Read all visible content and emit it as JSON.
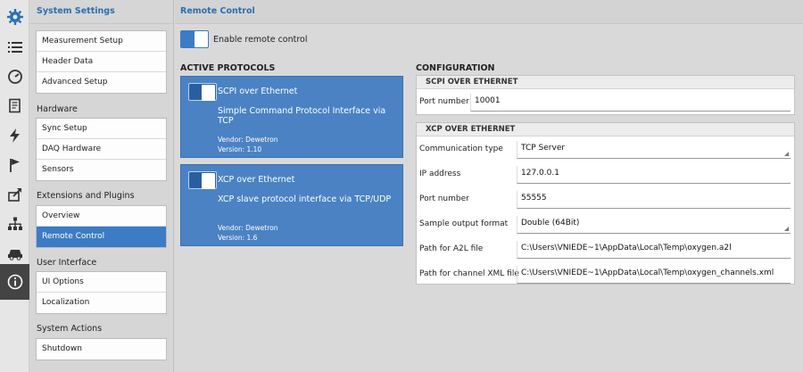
{
  "rail": {
    "icons": [
      "gear-icon",
      "list-icon",
      "gauge-icon",
      "document-icon",
      "lightning-icon",
      "flag-icon",
      "share-icon",
      "network-icon",
      "car-icon",
      "info-icon"
    ]
  },
  "sidebar": {
    "title": "System Settings",
    "groups": [
      {
        "label": "",
        "items": [
          "Measurement Setup",
          "Header Data",
          "Advanced Setup"
        ]
      },
      {
        "label": "Hardware",
        "items": [
          "Sync Setup",
          "DAQ Hardware",
          "Sensors"
        ]
      },
      {
        "label": "Extensions and Plugins",
        "items": [
          "Overview",
          "Remote Control"
        ]
      },
      {
        "label": "User Interface",
        "items": [
          "UI Options",
          "Localization"
        ]
      },
      {
        "label": "System Actions",
        "items": [
          "Shutdown"
        ]
      }
    ],
    "active_item": "Remote Control"
  },
  "main": {
    "title": "Remote Control",
    "enable_label": "Enable remote control",
    "protocols_title": "ACTIVE PROTOCOLS",
    "configuration_title": "CONFIGURATION",
    "protocols": [
      {
        "name": "SCPI over Ethernet",
        "description": "Simple Command Protocol Interface via TCP",
        "vendor": "Vendor: Dewetron",
        "version": "Version: 1.10"
      },
      {
        "name": "XCP over Ethernet",
        "description": "XCP slave protocol interface via TCP/UDP",
        "vendor": "Vendor: Dewetron",
        "version": "Version: 1.6"
      }
    ],
    "scpi": {
      "header": "SCPI OVER ETHERNET",
      "port_label": "Port number",
      "port_value": "10001"
    },
    "xcp": {
      "header": "XCP OVER ETHERNET",
      "rows": [
        {
          "label": "Communication type",
          "value": "TCP Server"
        },
        {
          "label": "IP address",
          "value": "127.0.0.1"
        },
        {
          "label": "Port number",
          "value": "55555"
        },
        {
          "label": "Sample output format",
          "value": "Double (64Bit)"
        },
        {
          "label": "Path for A2L file",
          "value": "C:\\Users\\VNIEDE~1\\AppData\\Local\\Temp\\oxygen.a2l"
        },
        {
          "label": "Path for channel XML file",
          "value": "C:\\Users\\VNIEDE~1\\AppData\\Local\\Temp\\oxygen_channels.xml"
        }
      ]
    }
  },
  "colors": {
    "accent": "#3b7cc4",
    "title_blue": "#2c6fb0",
    "card_blue": "#4a82c4"
  }
}
